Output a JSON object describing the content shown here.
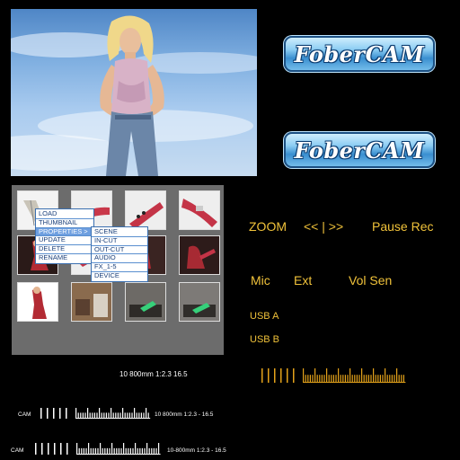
{
  "logos": [
    "FoberCAM",
    "FoberCAM"
  ],
  "menu": {
    "primary": [
      "LOAD",
      "THUMBNAIL",
      "PROPERTIES  >",
      "UPDATE",
      "DELETE",
      "RENAME"
    ],
    "submenu": [
      "SCENE",
      "IN-CUT",
      "OUT-CUT",
      "AUDIO",
      "FX_1-5",
      "DEVICE"
    ]
  },
  "controls": {
    "zoom": "ZOOM",
    "rewind_fwd": "<< | >>",
    "pause_rec": "Pause  Rec",
    "mic": "Mic",
    "ext": "Ext",
    "vol_sen": "Vol  Sen",
    "usb_a": "USB  A",
    "usb_b": "USB  B"
  },
  "lens_readouts": {
    "main": "10 800mm 1:2.3    16.5",
    "small1_cam": "CAM",
    "small1_lens": "10 800mm 1:2.3 - 16.5",
    "small2_cam": "CAM",
    "small2_lens": "10-800mm 1:2.3 - 16.5"
  },
  "colors": {
    "accent": "#f0c23a",
    "panel": "#6c6c6c",
    "scale_orange": "#e3a21a"
  },
  "icons": [
    "guitar",
    "performer",
    "studio",
    "logo"
  ]
}
